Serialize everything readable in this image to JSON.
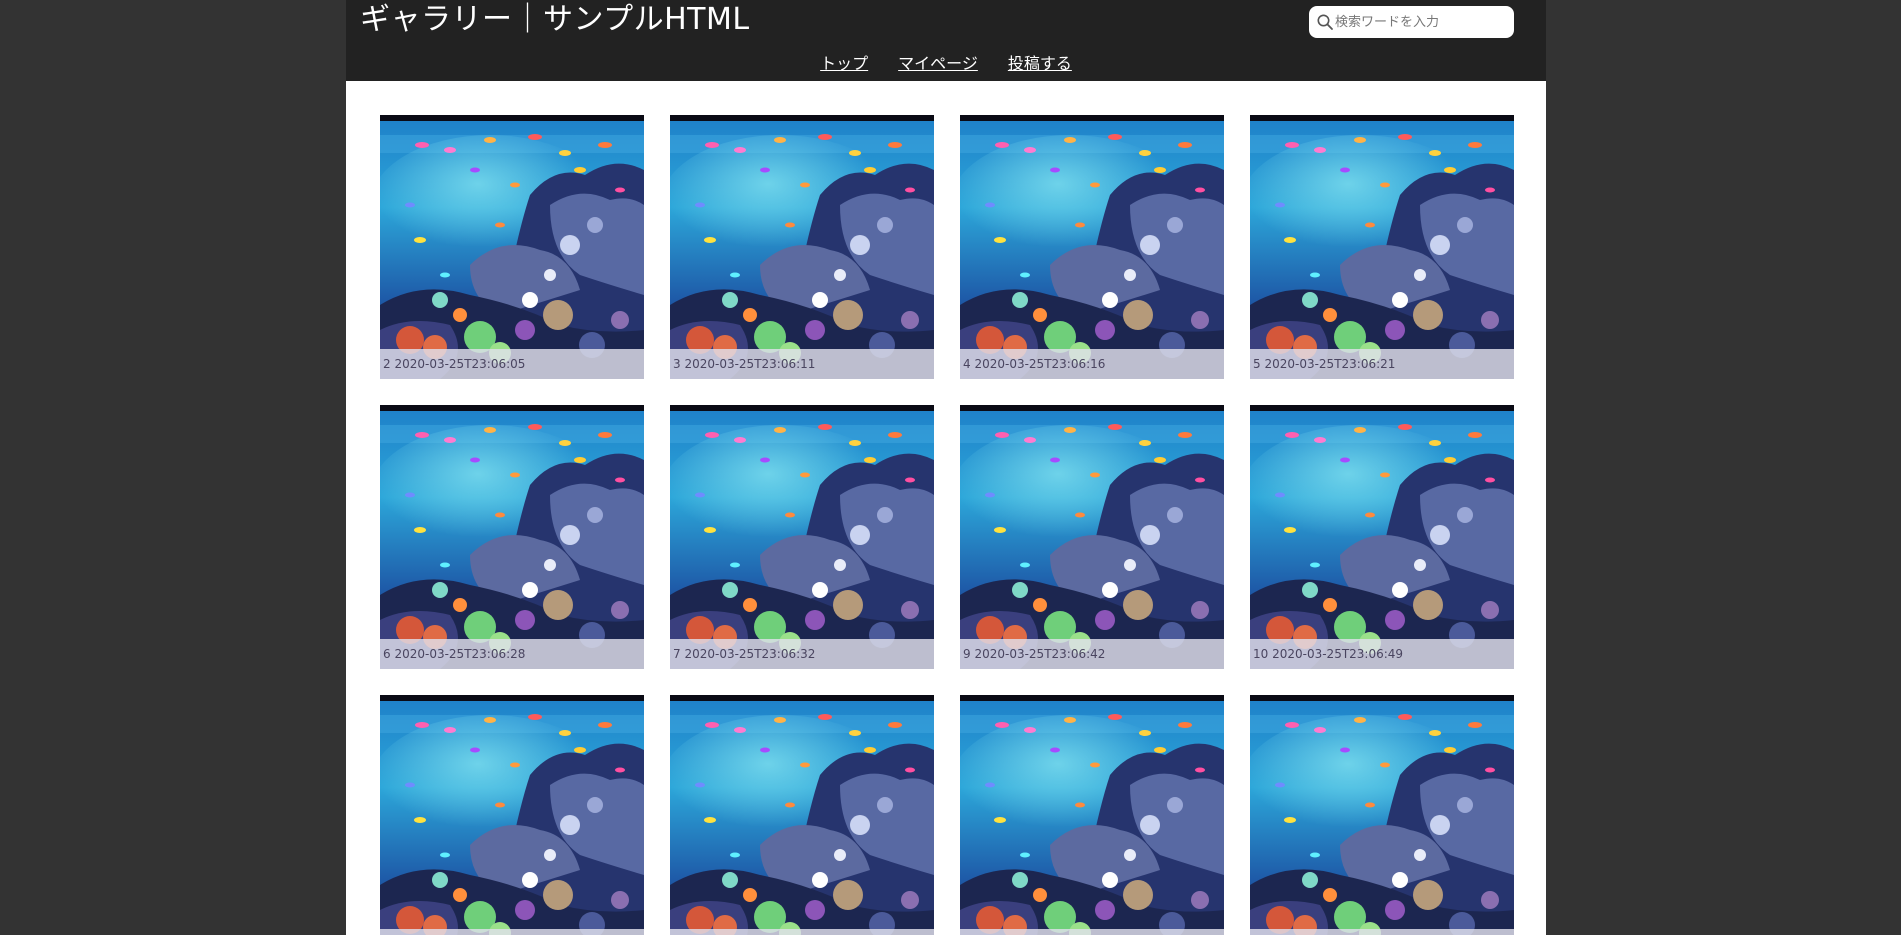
{
  "header": {
    "title": "ギャラリー｜サンプルHTML",
    "search_placeholder": "検索ワードを入力"
  },
  "nav": {
    "items": [
      {
        "label": "トップ"
      },
      {
        "label": "マイページ"
      },
      {
        "label": "投稿する"
      }
    ]
  },
  "gallery": {
    "items": [
      {
        "caption": "2 2020-03-25T23:06:05"
      },
      {
        "caption": "3 2020-03-25T23:06:11"
      },
      {
        "caption": "4 2020-03-25T23:06:16"
      },
      {
        "caption": "5 2020-03-25T23:06:21"
      },
      {
        "caption": "6 2020-03-25T23:06:28"
      },
      {
        "caption": "7 2020-03-25T23:06:32"
      },
      {
        "caption": "9 2020-03-25T23:06:42"
      },
      {
        "caption": "10 2020-03-25T23:06:49"
      },
      {
        "caption": ""
      },
      {
        "caption": ""
      },
      {
        "caption": ""
      },
      {
        "caption": ""
      }
    ]
  },
  "colors": {
    "page_background": "#333333",
    "header_background": "#222222",
    "content_background": "#ffffff"
  }
}
